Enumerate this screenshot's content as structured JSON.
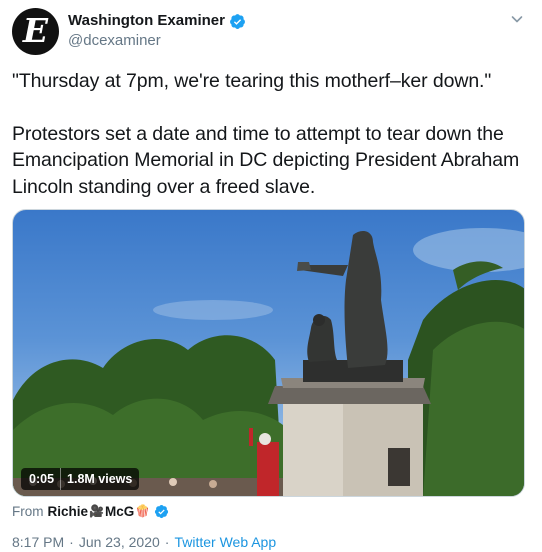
{
  "author": {
    "display_name": "Washington Examiner",
    "handle": "@dcexaminer",
    "avatar_letter": "E",
    "verified": true
  },
  "tweet": {
    "quote": "\"Thursday at 7pm, we're tearing this motherf–ker down.\"",
    "body": "Protestors set a date and time to attempt to tear down the Emancipation Memorial in DC depicting President Abraham Lincoln standing over a freed slave."
  },
  "media": {
    "type": "video",
    "duration": "0:05",
    "views": "1.8M views"
  },
  "attribution": {
    "prefix": "From",
    "source_name": "Richie",
    "emoji_camera": "🎥",
    "source_name_2": "McG",
    "emoji_popcorn": "🍿",
    "verified": true
  },
  "footer": {
    "time": "8:17 PM",
    "date": "Jun 23, 2020",
    "separator": "·",
    "client": "Twitter Web App"
  },
  "colors": {
    "text_primary": "#14171a",
    "text_secondary": "#657786",
    "link": "#1b95e0",
    "verified": "#1da1f2"
  },
  "icons": [
    "verified-badge-icon",
    "caret-down-icon"
  ]
}
